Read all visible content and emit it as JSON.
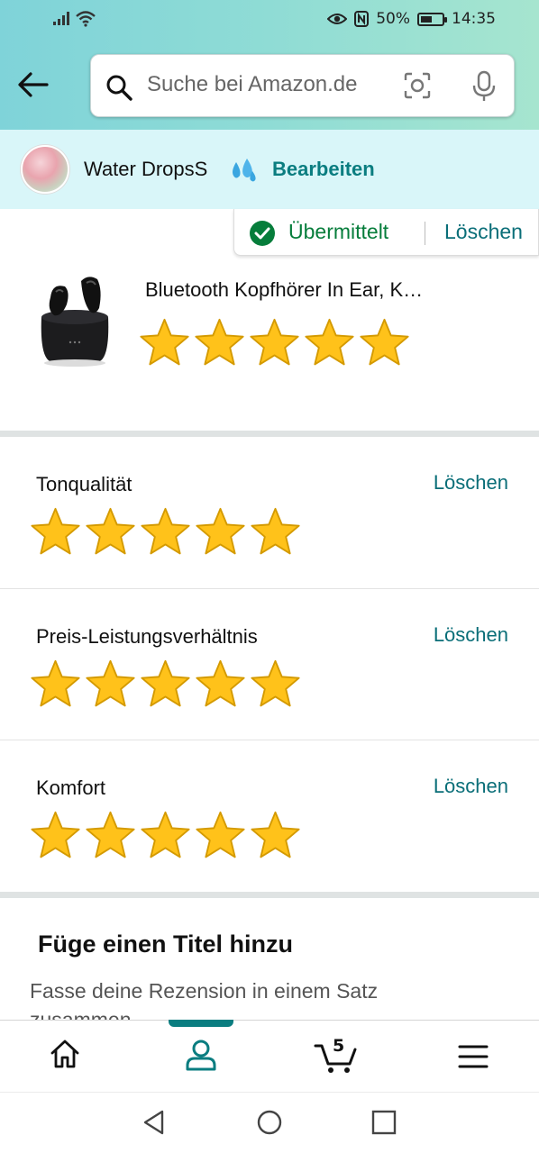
{
  "status_bar": {
    "battery": "50%",
    "time": "14:35"
  },
  "search": {
    "placeholder": "Suche bei Amazon.de"
  },
  "profile": {
    "name": "Water DropsS",
    "edit_label": "Bearbeiten"
  },
  "review_status": {
    "submitted_label": "Übermittelt",
    "delete_label": "Löschen"
  },
  "product": {
    "title": "Bluetooth Kopfhörer In Ear, K…",
    "rating": 5
  },
  "ratings": [
    {
      "label": "Tonqualität",
      "stars": 5,
      "delete_label": "Löschen"
    },
    {
      "label": "Preis-Leistungsverhältnis",
      "stars": 5,
      "delete_label": "Löschen"
    },
    {
      "label": "Komfort",
      "stars": 5,
      "delete_label": "Löschen"
    }
  ],
  "title_section": {
    "heading": "Füge einen Titel hinzu",
    "hint": "Fasse deine Rezension in einem Satz zusammen"
  },
  "bottom_nav": {
    "cart_count": "5",
    "items": [
      "home-icon",
      "account-icon",
      "cart-icon",
      "menu-icon"
    ]
  },
  "colors": {
    "accent": "#0a7d80",
    "star": "#ffc21a",
    "submitted": "#067d3b"
  }
}
